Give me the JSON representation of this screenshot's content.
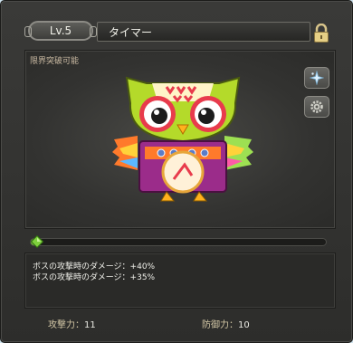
{
  "header": {
    "level_label": "Lv.5",
    "item_name": "タイマー"
  },
  "display": {
    "limit_break_text": "限界突破可能"
  },
  "progress": {
    "fraction": 0.03
  },
  "potential": {
    "lines": [
      "ボスの攻撃時のダメージ：+40%",
      "ボスの攻撃時のダメージ：+35%"
    ]
  },
  "stats": {
    "attack_label": "攻撃力：",
    "attack_value": "11",
    "defense_label": "防御力：",
    "defense_value": "10"
  },
  "icons": {
    "lock": "lock-icon",
    "star": "sparkle-icon",
    "gear": "gear-icon",
    "gem": "green-gem-icon"
  },
  "colors": {
    "panel_bg": "#333331",
    "progress_fill": "#7ac23a",
    "stat_label": "#d5c9a7"
  }
}
